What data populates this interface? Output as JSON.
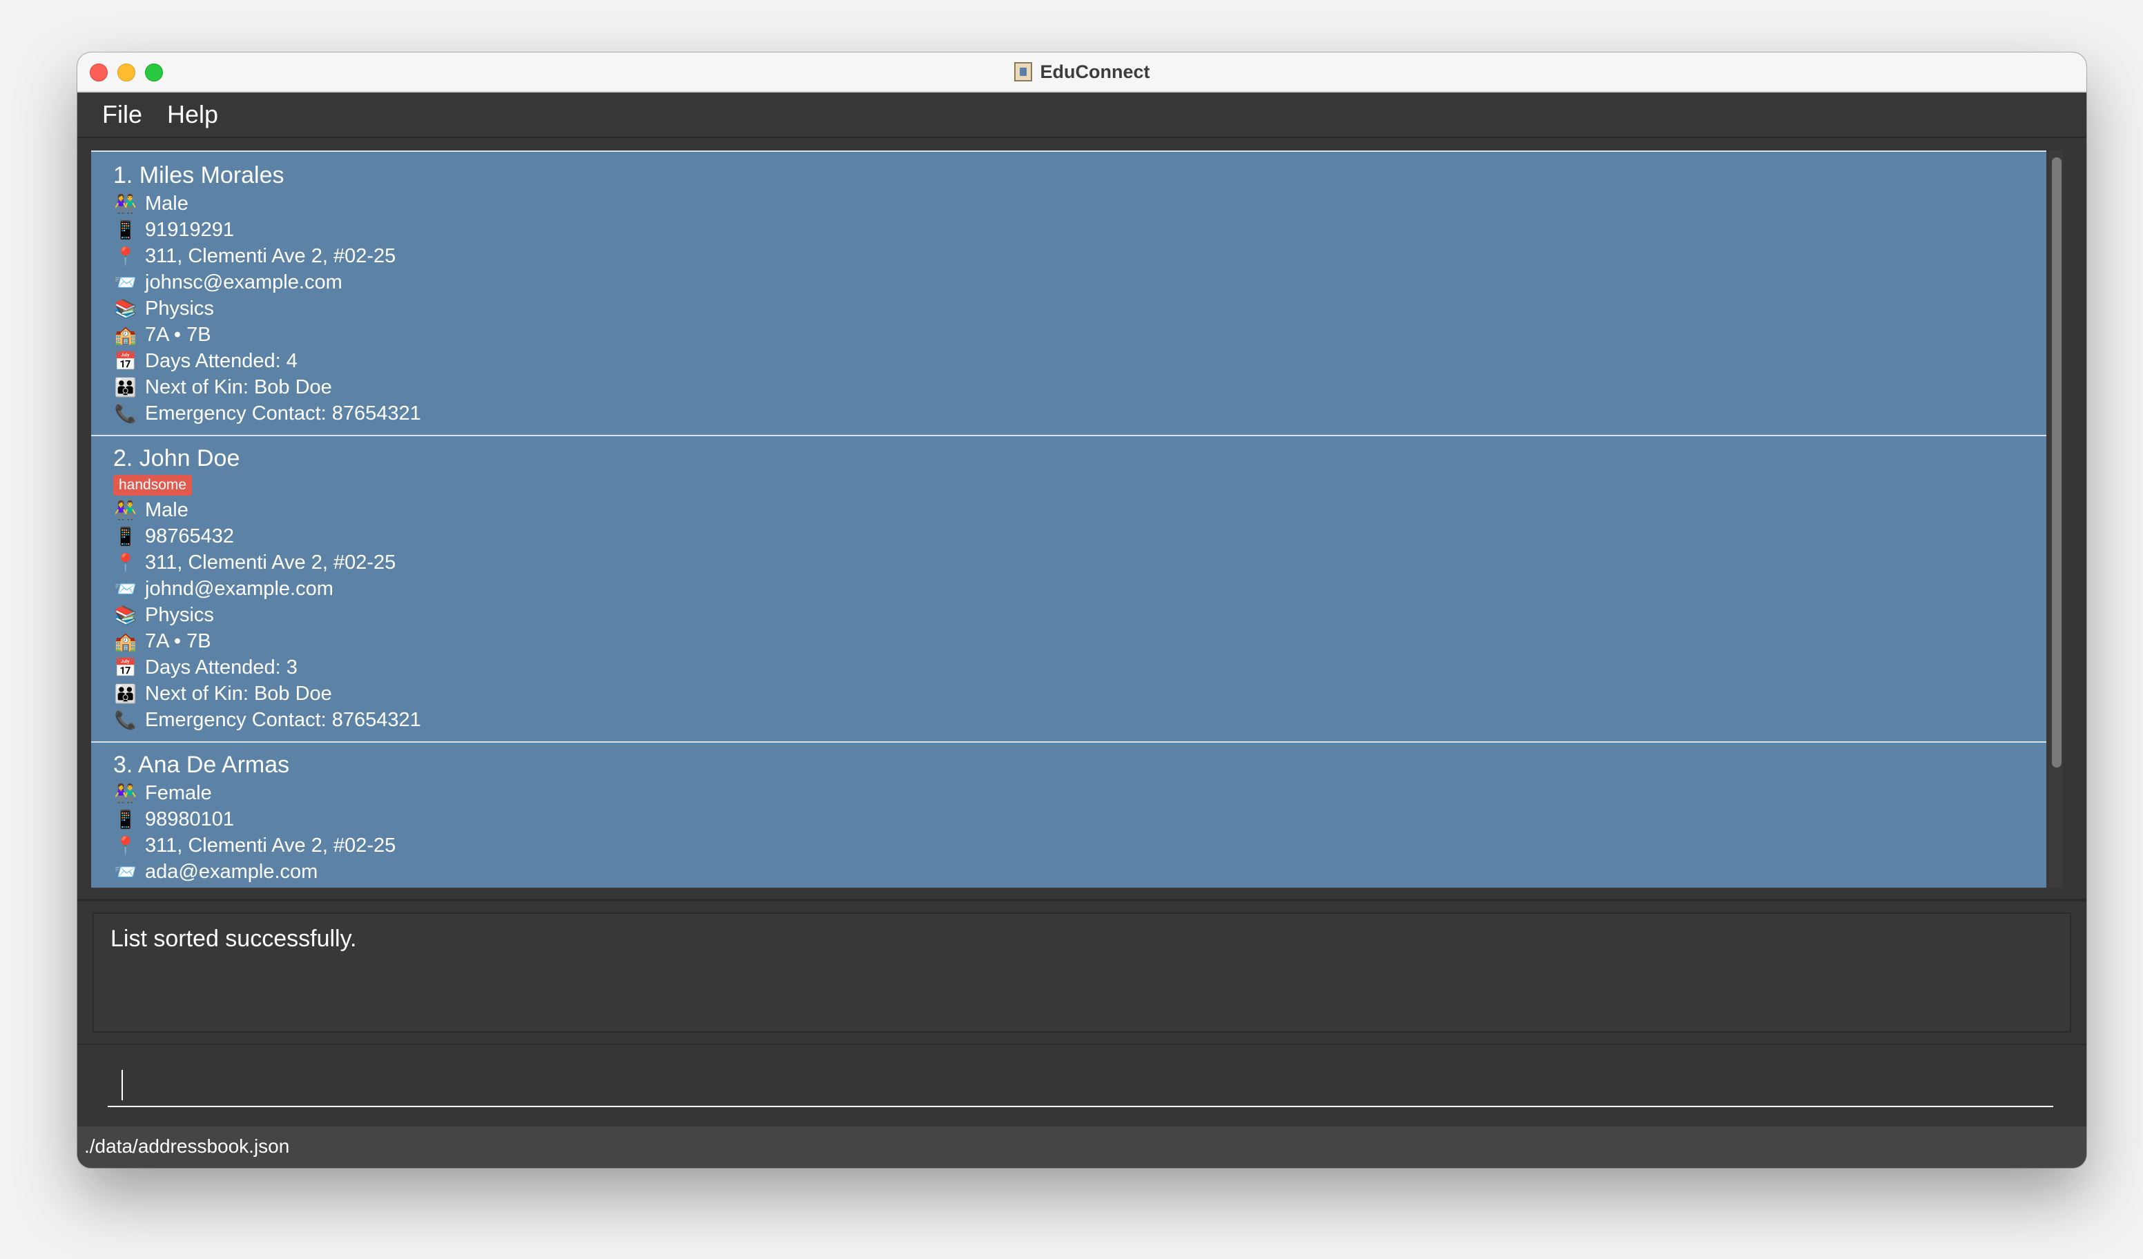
{
  "window": {
    "title": "EduConnect"
  },
  "menu": {
    "items": [
      "File",
      "Help"
    ]
  },
  "persons": [
    {
      "name": "1. Miles Morales",
      "tags": [],
      "gender": "Male",
      "phone": "91919291",
      "address": "311, Clementi Ave 2, #02-25",
      "email": "johnsc@example.com",
      "subject": "Physics",
      "classes": "7A • 7B",
      "attendance": "Days Attended: 4",
      "next_of_kin": "Next of Kin: Bob Doe",
      "emergency_contact": "Emergency Contact: 87654321"
    },
    {
      "name": "2. John Doe",
      "tags": [
        "handsome"
      ],
      "gender": "Male",
      "phone": "98765432",
      "address": "311, Clementi Ave 2, #02-25",
      "email": "johnd@example.com",
      "subject": "Physics",
      "classes": "7A • 7B",
      "attendance": "Days Attended: 3",
      "next_of_kin": "Next of Kin: Bob Doe",
      "emergency_contact": "Emergency Contact: 87654321"
    },
    {
      "name": "3. Ana De Armas",
      "tags": [],
      "gender": "Female",
      "phone": "98980101",
      "address": "311, Clementi Ave 2, #02-25",
      "email": "ada@example.com"
    }
  ],
  "icons": {
    "gender": "people-icon",
    "phone": "mobile-phone-icon",
    "address": "location-pin-icon",
    "email": "envelope-icon",
    "subject": "books-icon",
    "classes": "school-icon",
    "attendance": "calendar-icon",
    "next_of_kin": "family-icon",
    "emergency_contact": "telephone-icon"
  },
  "result": {
    "message": "List sorted successfully."
  },
  "command": {
    "value": ""
  },
  "status": {
    "file_path": "./data/addressbook.json"
  },
  "colors": {
    "card_background": "#5c83a6",
    "tag_background": "#e2594d",
    "window_background": "#363636"
  }
}
